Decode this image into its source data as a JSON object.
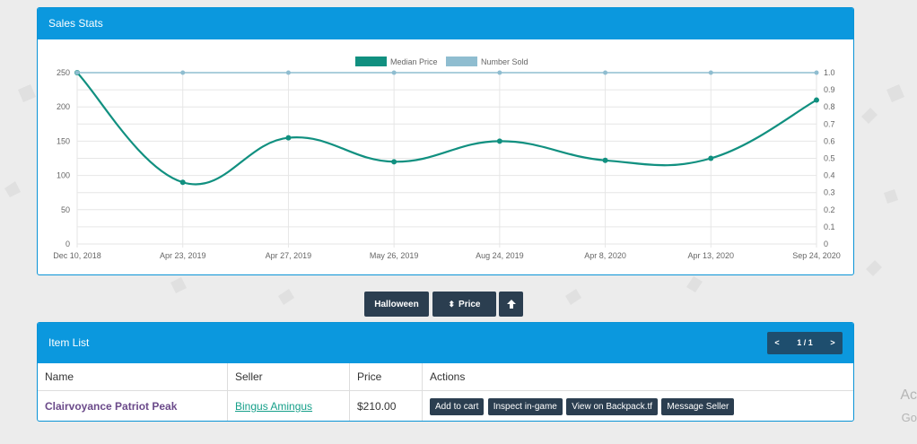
{
  "sales_panel": {
    "title": "Sales Stats"
  },
  "chart_data": {
    "type": "line",
    "legend": [
      "Median Price",
      "Number Sold"
    ],
    "categories": [
      "Dec 10, 2018",
      "Apr 23, 2019",
      "Apr 27, 2019",
      "May 26, 2019",
      "Aug 24, 2019",
      "Apr 8, 2020",
      "Apr 13, 2020",
      "Sep 24, 2020"
    ],
    "series": [
      {
        "name": "Median Price",
        "axis": "left",
        "color": "#119080",
        "values": [
          250,
          90,
          155,
          120,
          150,
          122,
          125,
          210
        ]
      },
      {
        "name": "Number Sold",
        "axis": "right",
        "color": "#8fbdd0",
        "values": [
          1,
          1,
          1,
          1,
          1,
          1,
          1,
          1
        ]
      }
    ],
    "y_left": {
      "min": 0,
      "max": 250,
      "ticks": [
        "0",
        "50",
        "100",
        "150",
        "200",
        "250"
      ]
    },
    "y_right": {
      "min": 0,
      "max": 1,
      "ticks": [
        "0",
        "0.1",
        "0.2",
        "0.3",
        "0.4",
        "0.5",
        "0.6",
        "0.7",
        "0.8",
        "0.9",
        "1.0"
      ]
    },
    "grid": true,
    "legend_position": "top"
  },
  "controls": {
    "filter_label": "Halloween",
    "sort_label": "Price",
    "sort_icon": "sort-icon",
    "direction_icon": "arrow-up-icon"
  },
  "items_panel": {
    "title": "Item List",
    "pager": {
      "prev": "<",
      "page": "1 / 1",
      "next": ">"
    },
    "columns": [
      "Name",
      "Seller",
      "Price",
      "Actions"
    ],
    "rows": [
      {
        "name": "Clairvoyance Patriot Peak",
        "seller": "Bingus Amingus",
        "price": "$210.00",
        "actions": [
          "Add to cart",
          "Inspect in-game",
          "View on Backpack.tf",
          "Message Seller"
        ]
      }
    ]
  },
  "edge": {
    "line1": "Ac",
    "line2": "Go"
  }
}
